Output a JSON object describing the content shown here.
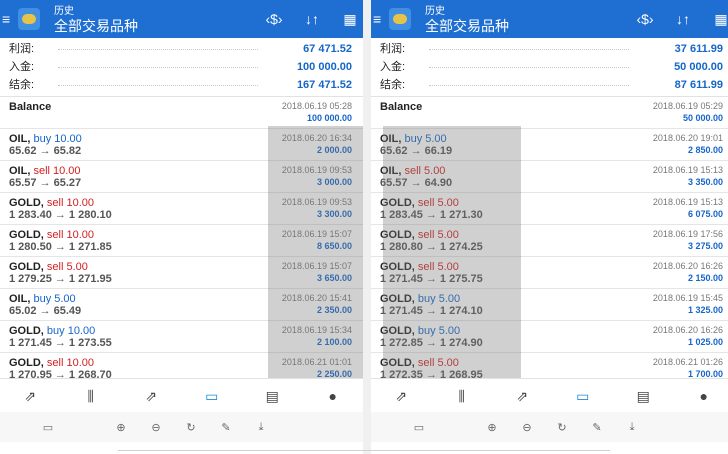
{
  "colors": {
    "header_bg": "#1f6fd3",
    "value_blue": "#1466c8",
    "sell_red": "#d21f1f"
  },
  "panels": [
    {
      "header": {
        "small_title": "历史",
        "main_title": "全部交易品种",
        "icons": [
          "menu-icon",
          "logo-icon",
          "currency-exchange-icon",
          "sort-icon",
          "calendar-icon"
        ]
      },
      "summary": [
        {
          "label": "利润:",
          "value": "67 471.52"
        },
        {
          "label": "入金:",
          "value": "100 000.00"
        },
        {
          "label": "结余:",
          "value": "167 471.52"
        }
      ],
      "balance": {
        "label": "Balance",
        "date": "2018.06.19 05:28",
        "amount": "100 000.00"
      },
      "trades": [
        {
          "symbol": "OIL,",
          "action": "buy 10.00",
          "side": "buy",
          "prices": "65.62 → 65.82",
          "date": "2018.06.20 16:34",
          "amount": "2 000.00"
        },
        {
          "symbol": "OIL,",
          "action": "sell 10.00",
          "side": "sell",
          "prices": "65.57 → 65.27",
          "date": "2018.06.19 09:53",
          "amount": "3 000.00"
        },
        {
          "symbol": "GOLD,",
          "action": "sell 10.00",
          "side": "sell",
          "prices": "1 283.40 → 1 280.10",
          "date": "2018.06.19 09:53",
          "amount": "3 300.00"
        },
        {
          "symbol": "GOLD,",
          "action": "sell 10.00",
          "side": "sell",
          "prices": "1 280.50 → 1 271.85",
          "date": "2018.06.19 15:07",
          "amount": "8 650.00"
        },
        {
          "symbol": "GOLD,",
          "action": "sell 5.00",
          "side": "sell",
          "prices": "1 279.25 → 1 271.95",
          "date": "2018.06.19 15:07",
          "amount": "3 650.00"
        },
        {
          "symbol": "OIL,",
          "action": "buy 5.00",
          "side": "buy",
          "prices": "65.02 → 65.49",
          "date": "2018.06.20 15:41",
          "amount": "2 350.00"
        },
        {
          "symbol": "GOLD,",
          "action": "buy 10.00",
          "side": "buy",
          "prices": "1 271.45 → 1 273.55",
          "date": "2018.06.19 15:34",
          "amount": "2 100.00"
        },
        {
          "symbol": "GOLD,",
          "action": "sell 10.00",
          "side": "sell",
          "prices": "1 270.95 → 1 268.70",
          "date": "2018.06.21 01:01",
          "amount": "2 250.00"
        }
      ]
    },
    {
      "header": {
        "small_title": "历史",
        "main_title": "全部交易品种",
        "icons": [
          "menu-icon",
          "logo-icon",
          "currency-exchange-icon",
          "sort-icon",
          "calendar-icon"
        ]
      },
      "summary": [
        {
          "label": "利润:",
          "value": "37 611.99"
        },
        {
          "label": "入金:",
          "value": "50 000.00"
        },
        {
          "label": "结余:",
          "value": "87 611.99"
        }
      ],
      "balance": {
        "label": "Balance",
        "date": "2018.06.19 05:29",
        "amount": "50 000.00"
      },
      "trades": [
        {
          "symbol": "OIL,",
          "action": "buy 5.00",
          "side": "buy",
          "prices": "65.62 → 66.19",
          "date": "2018.06.20 19:01",
          "amount": "2 850.00"
        },
        {
          "symbol": "OIL,",
          "action": "sell 5.00",
          "side": "sell",
          "prices": "65.57 → 64.90",
          "date": "2018.06.19 15:13",
          "amount": "3 350.00"
        },
        {
          "symbol": "GOLD,",
          "action": "sell 5.00",
          "side": "sell",
          "prices": "1 283.45 → 1 271.30",
          "date": "2018.06.19 15:13",
          "amount": "6 075.00"
        },
        {
          "symbol": "GOLD,",
          "action": "sell 5.00",
          "side": "sell",
          "prices": "1 280.80 → 1 274.25",
          "date": "2018.06.19 17:56",
          "amount": "3 275.00"
        },
        {
          "symbol": "GOLD,",
          "action": "sell 5.00",
          "side": "sell",
          "prices": "1 271.45 → 1 275.75",
          "date": "2018.06.20 16:26",
          "amount": "2 150.00"
        },
        {
          "symbol": "GOLD,",
          "action": "buy 5.00",
          "side": "buy",
          "prices": "1 271.45 → 1 274.10",
          "date": "2018.06.19 15:45",
          "amount": "1 325.00"
        },
        {
          "symbol": "GOLD,",
          "action": "buy 5.00",
          "side": "buy",
          "prices": "1 272.85 → 1 274.90",
          "date": "2018.06.20 16:26",
          "amount": "1 025.00"
        },
        {
          "symbol": "GOLD,",
          "action": "sell 5.00",
          "side": "sell",
          "prices": "1 272.35 → 1 268.95",
          "date": "2018.06.21 01:26",
          "amount": "1 700.00"
        }
      ]
    }
  ],
  "tabbar": [
    {
      "name": "trade-tab-icon",
      "glyph": "⇗",
      "active": false
    },
    {
      "name": "quotes-tab-icon",
      "glyph": "⫼",
      "active": false
    },
    {
      "name": "chart-tab-icon",
      "glyph": "⇗",
      "active": false
    },
    {
      "name": "history-tab-icon",
      "glyph": "▭",
      "active": true
    },
    {
      "name": "news-tab-icon",
      "glyph": "▤",
      "active": false
    },
    {
      "name": "chat-tab-icon",
      "glyph": "●",
      "active": false
    }
  ],
  "toolbar": [
    {
      "name": "device-icon",
      "glyph": "▭"
    },
    {
      "name": "zoom-in-icon",
      "glyph": "⊕"
    },
    {
      "name": "zoom-out-icon",
      "glyph": "⊖"
    },
    {
      "name": "rotate-icon",
      "glyph": "↻"
    },
    {
      "name": "edit-icon",
      "glyph": "✎"
    },
    {
      "name": "download-icon",
      "glyph": "⤓"
    }
  ]
}
